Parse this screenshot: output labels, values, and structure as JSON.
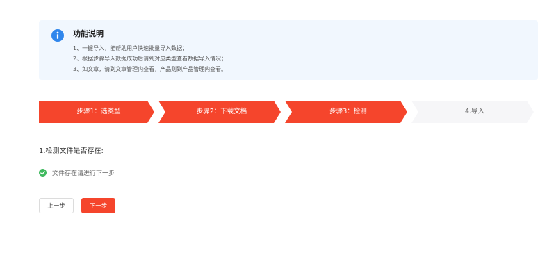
{
  "info": {
    "title": "功能说明",
    "icon": "info-icon",
    "lines": [
      "1、一键导入，能帮助用户快速批量导入数据；",
      "2、根据步骤导入数据成功后请到对应类型查看数据导入情况；",
      "3、如文章，请到文章管理内查看，产品则到产品管理内查看。"
    ]
  },
  "steps": [
    {
      "label": "步骤1：选类型",
      "status": "done"
    },
    {
      "label": "步骤2：下载文档",
      "status": "done"
    },
    {
      "label": "步骤3：检测",
      "status": "done"
    },
    {
      "label": "4.导入",
      "status": "todo"
    }
  ],
  "check": {
    "title": "1.检测文件是否存在:",
    "result_text": "文件存在请进行下一步",
    "result_icon": "check-circle-icon"
  },
  "buttons": {
    "prev_label": "上一步",
    "next_label": "下一步"
  },
  "colors": {
    "accent": "#f5452c",
    "info_bg": "#f1f7fe",
    "info_icon": "#2f86ec",
    "success": "#3fb95e"
  }
}
